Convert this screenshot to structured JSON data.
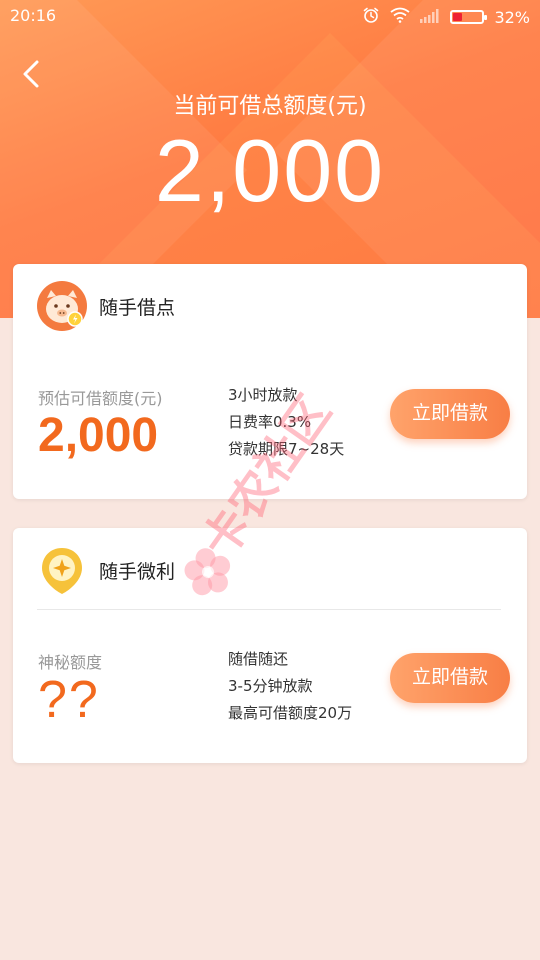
{
  "status_bar": {
    "time": "20:16",
    "battery_percent": "32%",
    "battery_level": 0.32,
    "icons": [
      "alarm-icon",
      "wifi-icon",
      "signal-icon",
      "battery-icon"
    ]
  },
  "header": {
    "title": "当前可借总额度(元)",
    "amount": "2,000"
  },
  "products": [
    {
      "name": "随手借点",
      "icon": "pig-icon",
      "quota_label": "预估可借额度(元)",
      "quota_value": "2,000",
      "features": [
        "3小时放款",
        "日费率0.3%",
        "贷款期限7~28天"
      ],
      "button": "立即借款"
    },
    {
      "name": "随手微利",
      "icon": "coin-icon",
      "quota_label": "神秘额度",
      "quota_value": "??",
      "features": [
        "随借随还",
        "3-5分钟放款",
        "最高可借额度20万"
      ],
      "button": "立即借款"
    }
  ],
  "watermark": "卡农社区",
  "colors": {
    "header_gradient_start": "#ff9a56",
    "header_gradient_end": "#ff6f3d",
    "accent": "#f2691e",
    "page_background": "#f9e6df"
  }
}
